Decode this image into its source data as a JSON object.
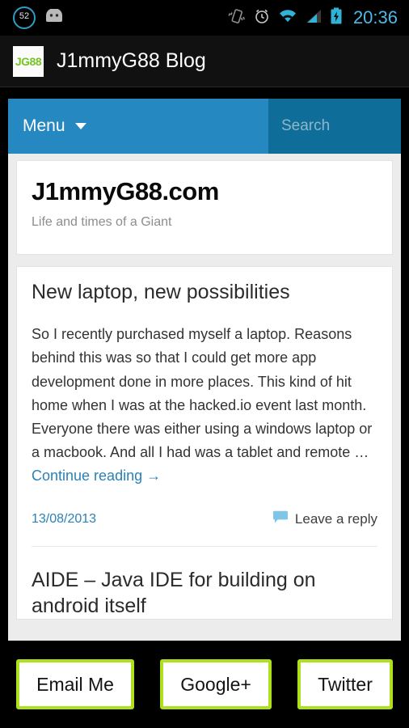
{
  "statusbar": {
    "notification_count": "52",
    "android_icon": "android-robot-icon",
    "vibrate_icon": "vibrate-icon",
    "alarm_icon": "alarm-clock-icon",
    "wifi_icon": "wifi-icon",
    "signal_icon": "cellular-signal-icon",
    "battery_icon": "battery-charging-icon",
    "time": "20:36",
    "time_color": "#4db8e8"
  },
  "actionbar": {
    "app_icon_text": "JG88",
    "app_icon_color": "#76c422",
    "title": "J1mmyG88 Blog"
  },
  "navbar": {
    "menu_label": "Menu",
    "menu_caret": "chevron-down-icon",
    "search_placeholder": "Search",
    "bar_color": "#2588c0",
    "search_color": "#0e6e99"
  },
  "site": {
    "title": "J1mmyG88.com",
    "tagline": "Life and times of a Giant"
  },
  "posts": [
    {
      "title": "New laptop, new possibilities",
      "excerpt": "So I recently purchased myself a laptop. Reasons behind this was so that I could get more app development done in more places. This kind of hit home when I was at the hacked.io event last month. Everyone there was either using a windows laptop or a macbook. And all I had was a tablet and remote … ",
      "continue_label": "Continue reading →",
      "date": "13/08/2013",
      "comment_icon": "comment-bubble-icon",
      "reply_label": "Leave a reply"
    },
    {
      "title": "AIDE – Java IDE for building on android itself"
    }
  ],
  "bottom_buttons": [
    {
      "label": "Email Me"
    },
    {
      "label": "Google+"
    },
    {
      "label": "Twitter"
    }
  ],
  "colors": {
    "accent_green": "#aee01e",
    "link_blue": "#2a81b8",
    "bubble_blue": "#7ec5e8"
  }
}
